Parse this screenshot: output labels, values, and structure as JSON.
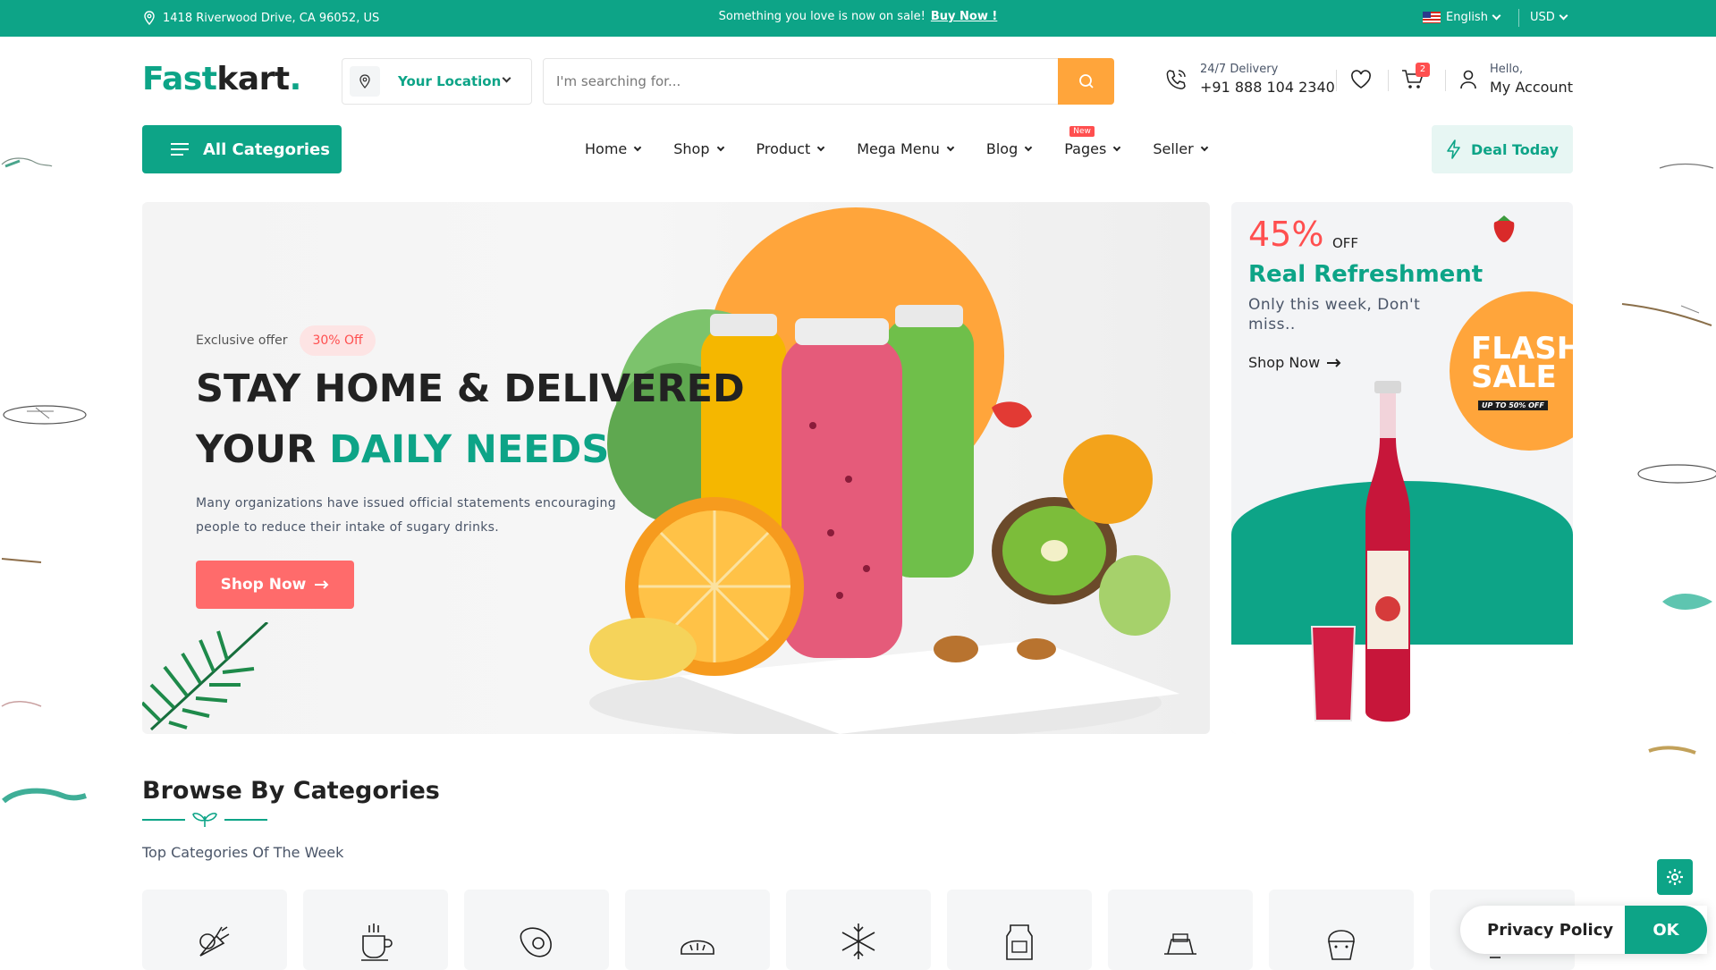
{
  "topbar": {
    "address": "1418 Riverwood Drive, CA 96052, US",
    "promo_text": "Something you love is now on sale!",
    "promo_link": "Buy Now !",
    "language": "English",
    "currency": "USD"
  },
  "header": {
    "logo_part1": "Fast",
    "logo_part2": "kart",
    "logo_dot": ".",
    "location_label": "Your Location",
    "search_placeholder": "I'm searching for...",
    "delivery_label": "24/7 Delivery",
    "delivery_phone": "+91 888 104 2340",
    "cart_count": "2",
    "account_greeting": "Hello,",
    "account_label": "My Account"
  },
  "nav": {
    "all_categories": "All Categories",
    "items": [
      {
        "label": "Home"
      },
      {
        "label": "Shop"
      },
      {
        "label": "Product"
      },
      {
        "label": "Mega Menu"
      },
      {
        "label": "Blog"
      },
      {
        "label": "Pages",
        "tag": "New"
      },
      {
        "label": "Seller"
      }
    ],
    "deal_today": "Deal Today"
  },
  "hero": {
    "exclusive": "Exclusive offer",
    "discount_pill": "30% Off",
    "title_line1": "STAY HOME & DELIVERED",
    "title_line2_a": "YOUR ",
    "title_line2_b": "DAILY NEEDS",
    "description": "Many organizations have issued official statements encouraging people to reduce their intake of sugary drinks.",
    "cta": "Shop Now"
  },
  "side_banner": {
    "percent": "45%",
    "off": "OFF",
    "title": "Real Refreshment",
    "subtitle": "Only this week, Don't miss..",
    "link": "Shop Now",
    "flash_line1": "FLASH",
    "flash_line2": "SALE",
    "flash_sub": "UP TO 50% OFF"
  },
  "browse": {
    "title": "Browse By Categories",
    "subtitle": "Top Categories Of The Week",
    "category_icons": [
      "vegetables-icon",
      "coffee-cup-icon",
      "meat-icon",
      "bread-icon",
      "snowflake-icon",
      "milk-carton-icon",
      "cake-tin-icon",
      "cupcake-icon",
      "more-icon"
    ]
  },
  "cookie": {
    "label": "Privacy Policy",
    "ok": "OK"
  },
  "colors": {
    "brand": "#0da487",
    "accent_orange": "#ffa53b",
    "accent_red": "#ff4f4f"
  }
}
